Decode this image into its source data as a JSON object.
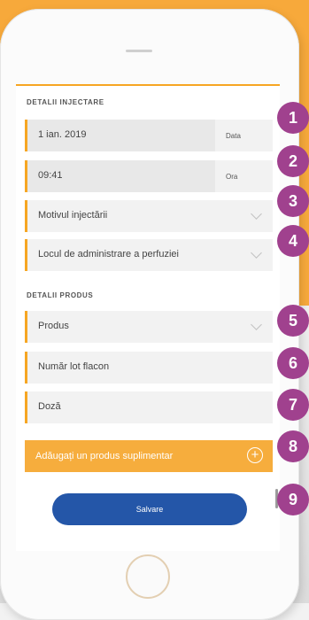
{
  "details_injection": {
    "section_title": "DETALII INJECTARE",
    "date": {
      "value": "1 ian. 2019",
      "label": "Data"
    },
    "time": {
      "value": "09:41",
      "label": "Ora"
    },
    "reason": {
      "placeholder": "Motivul injectării"
    },
    "site": {
      "placeholder": "Locul de administrare a perfuziei"
    }
  },
  "product_details": {
    "section_title": "DETALII PRODUS",
    "product": {
      "placeholder": "Produs"
    },
    "lot": {
      "placeholder": "Număr lot flacon"
    },
    "dose": {
      "placeholder": "Doză"
    }
  },
  "add_product_button": "Adăugați un produs suplimentar",
  "save_button": "Salvare",
  "badges": [
    "1",
    "2",
    "3",
    "4",
    "5",
    "6",
    "7",
    "8",
    "9"
  ],
  "colors": {
    "accent_orange": "#f6a623",
    "primary_blue": "#2456a8",
    "badge_purple": "#a0418e"
  }
}
